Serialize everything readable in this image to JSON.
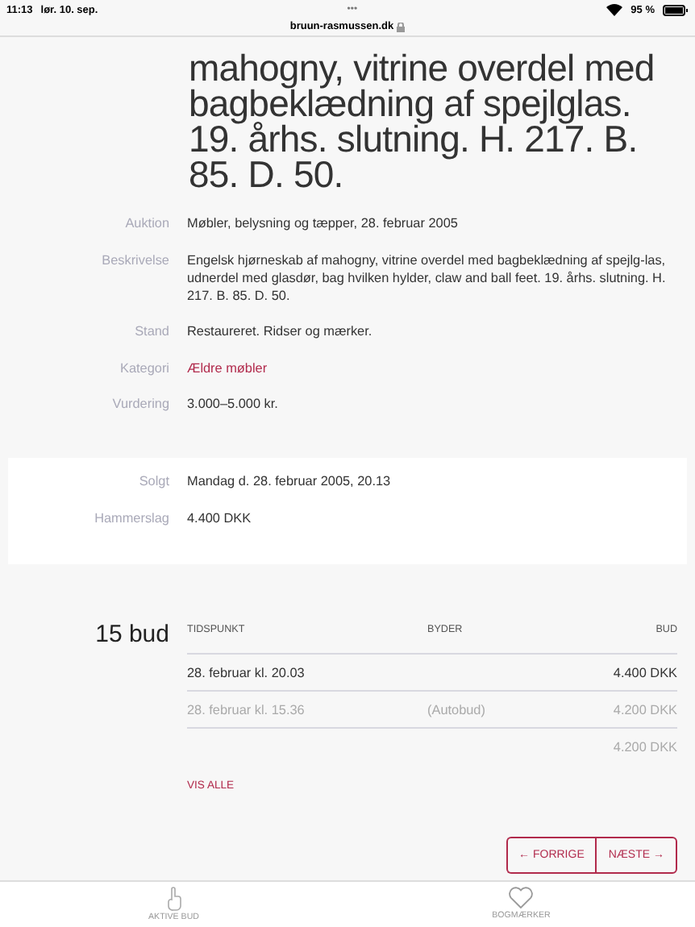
{
  "status_bar": {
    "time": "11:13",
    "date": "lør. 10. sep.",
    "dots": "•••",
    "battery": "95 %"
  },
  "address_bar": {
    "url": "bruun-rasmussen.dk"
  },
  "title_visible": "mahogny, vitrine overdel med bagbeklædning af spejlglas. 19. århs. slutning. H. 217. B. 85. D. 50.",
  "details": [
    {
      "label": "Auktion",
      "value": "Møbler, belysning og tæpper, 28. februar 2005",
      "kind": "text"
    },
    {
      "label": "Beskrivelse",
      "value": "Engelsk hjørneskab af mahogny, vitrine overdel med bagbeklædning af spejlg-las, udnerdel med glasdør, bag hvilken hylder, claw and ball feet. 19. århs. slutning. H. 217. B. 85. D. 50.",
      "kind": "text"
    },
    {
      "label": "Stand",
      "value": "Restaureret. Ridser og mærker.",
      "kind": "text"
    },
    {
      "label": "Kategori",
      "value": "Ældre møbler",
      "kind": "link"
    },
    {
      "label": "Vurdering",
      "value": "3.000–5.000 kr.",
      "kind": "text"
    }
  ],
  "sale": [
    {
      "label": "Solgt",
      "value": "Mandag d. 28. februar 2005, 20.13"
    },
    {
      "label": "Hammerslag",
      "value": "4.400 DKK"
    }
  ],
  "bids": {
    "count": "15 bud",
    "columns": [
      "TIDSPUNKT",
      "BYDER",
      "BUD"
    ],
    "rows": [
      {
        "time": "28. februar kl. 20.03",
        "bidder": "",
        "amount": "4.400 DKK",
        "winning": true
      },
      {
        "time": "28. februar kl. 15.36",
        "bidder": "(Autobud)",
        "amount": "4.200 DKK",
        "winning": false
      },
      {
        "time": "",
        "bidder": "",
        "amount": "4.200 DKK",
        "winning": false
      }
    ],
    "show_all": "VIS ALLE"
  },
  "pager": {
    "previous": "← FORRIGE",
    "next": "NÆSTE →"
  },
  "tab_bar": [
    {
      "label": "AKTIVE BUD",
      "kind": "hand"
    },
    {
      "label": "BOGMÆRKER",
      "kind": "heart"
    }
  ]
}
